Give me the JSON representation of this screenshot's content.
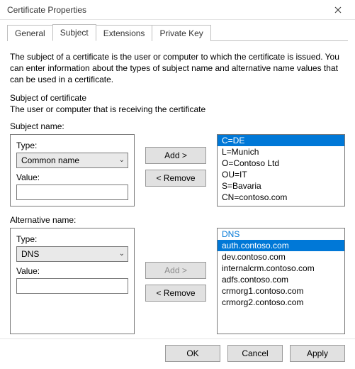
{
  "window": {
    "title": "Certificate Properties"
  },
  "tabs": [
    "General",
    "Subject",
    "Extensions",
    "Private Key"
  ],
  "body": {
    "description": "The subject of a certificate is the user or computer to which the certificate is issued. You can enter information about the types of subject name and alternative name values that can be used in a certificate.",
    "subject_heading": "Subject of certificate",
    "subject_sub": "The user or computer that is receiving the certificate"
  },
  "subject": {
    "group_label": "Subject name:",
    "type_label": "Type:",
    "type_value": "Common name",
    "value_label": "Value:",
    "value_text": "",
    "list": [
      {
        "text": "C=DE",
        "selected": true
      },
      {
        "text": "L=Munich",
        "selected": false
      },
      {
        "text": "O=Contoso Ltd",
        "selected": false
      },
      {
        "text": "OU=IT",
        "selected": false
      },
      {
        "text": "S=Bavaria",
        "selected": false
      },
      {
        "text": "CN=contoso.com",
        "selected": false
      }
    ]
  },
  "alt": {
    "group_label": "Alternative name:",
    "type_label": "Type:",
    "type_value": "DNS",
    "value_label": "Value:",
    "value_text": "",
    "header": "DNS",
    "list": [
      {
        "text": "auth.contoso.com",
        "selected": true
      },
      {
        "text": "dev.contoso.com",
        "selected": false
      },
      {
        "text": "internalcrm.contoso.com",
        "selected": false
      },
      {
        "text": "adfs.contoso.com",
        "selected": false
      },
      {
        "text": "crmorg1.contoso.com",
        "selected": false
      },
      {
        "text": "crmorg2.contoso.com",
        "selected": false
      }
    ]
  },
  "buttons": {
    "add": "Add >",
    "remove": "< Remove"
  },
  "footer": {
    "ok": "OK",
    "cancel": "Cancel",
    "apply": "Apply"
  }
}
